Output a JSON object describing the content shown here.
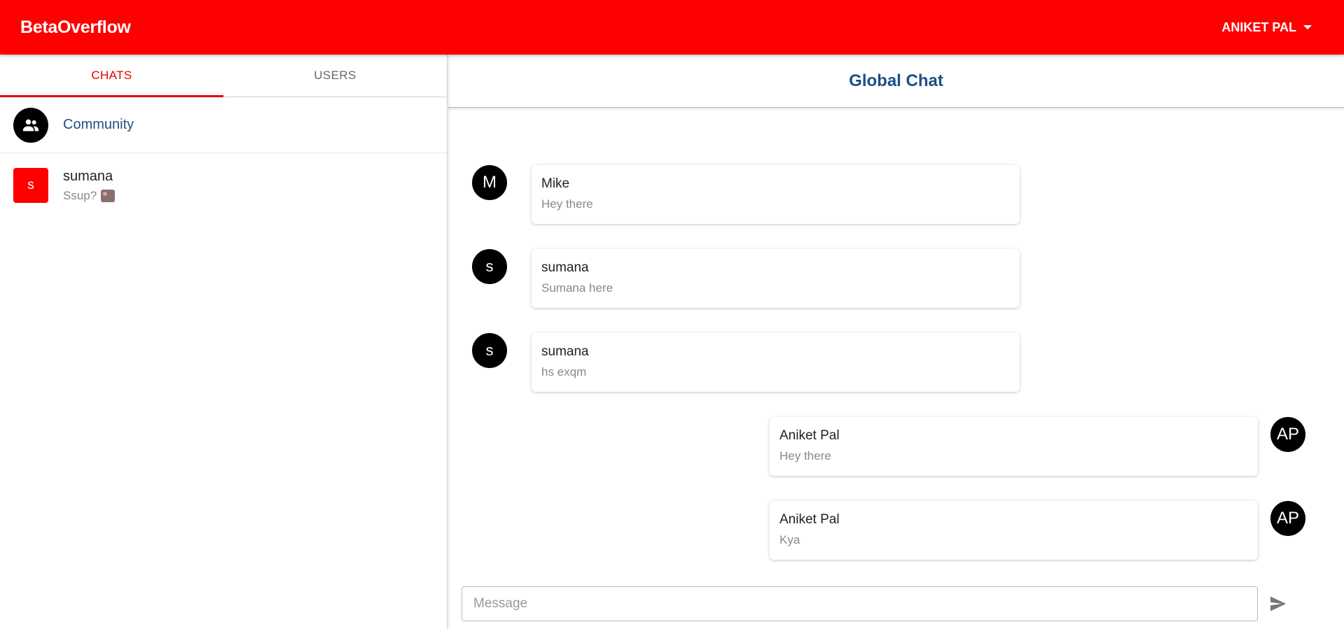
{
  "app": {
    "brand": "BetaOverflow",
    "user_menu_label": "ANIKET PAL"
  },
  "sidebar": {
    "tabs": [
      {
        "label": "CHATS",
        "active": true
      },
      {
        "label": "USERS",
        "active": false
      }
    ],
    "chats": [
      {
        "name": "Community",
        "type": "group"
      },
      {
        "name": "sumana",
        "initial": "s",
        "preview": "Ssup?"
      }
    ]
  },
  "chat": {
    "title": "Global Chat",
    "messages": [
      {
        "avatar": "M",
        "sender": "Mike",
        "text": "Hey there",
        "side": "left"
      },
      {
        "avatar": "s",
        "sender": "sumana",
        "text": "Sumana here",
        "side": "left"
      },
      {
        "avatar": "s",
        "sender": "sumana",
        "text": "hs exqm",
        "side": "left"
      },
      {
        "avatar": "AP",
        "sender": "Aniket Pal",
        "text": "Hey there",
        "side": "right"
      },
      {
        "avatar": "AP",
        "sender": "Aniket Pal",
        "text": "Kya",
        "side": "right"
      }
    ],
    "composer": {
      "placeholder": "Message",
      "value": ""
    }
  },
  "colors": {
    "accent": "#ff0000",
    "title_blue": "#1d4f85"
  },
  "icons": {
    "community": "group-icon",
    "dropdown": "caret-down-icon",
    "send": "send-icon",
    "emoji": "emoji-icon"
  }
}
